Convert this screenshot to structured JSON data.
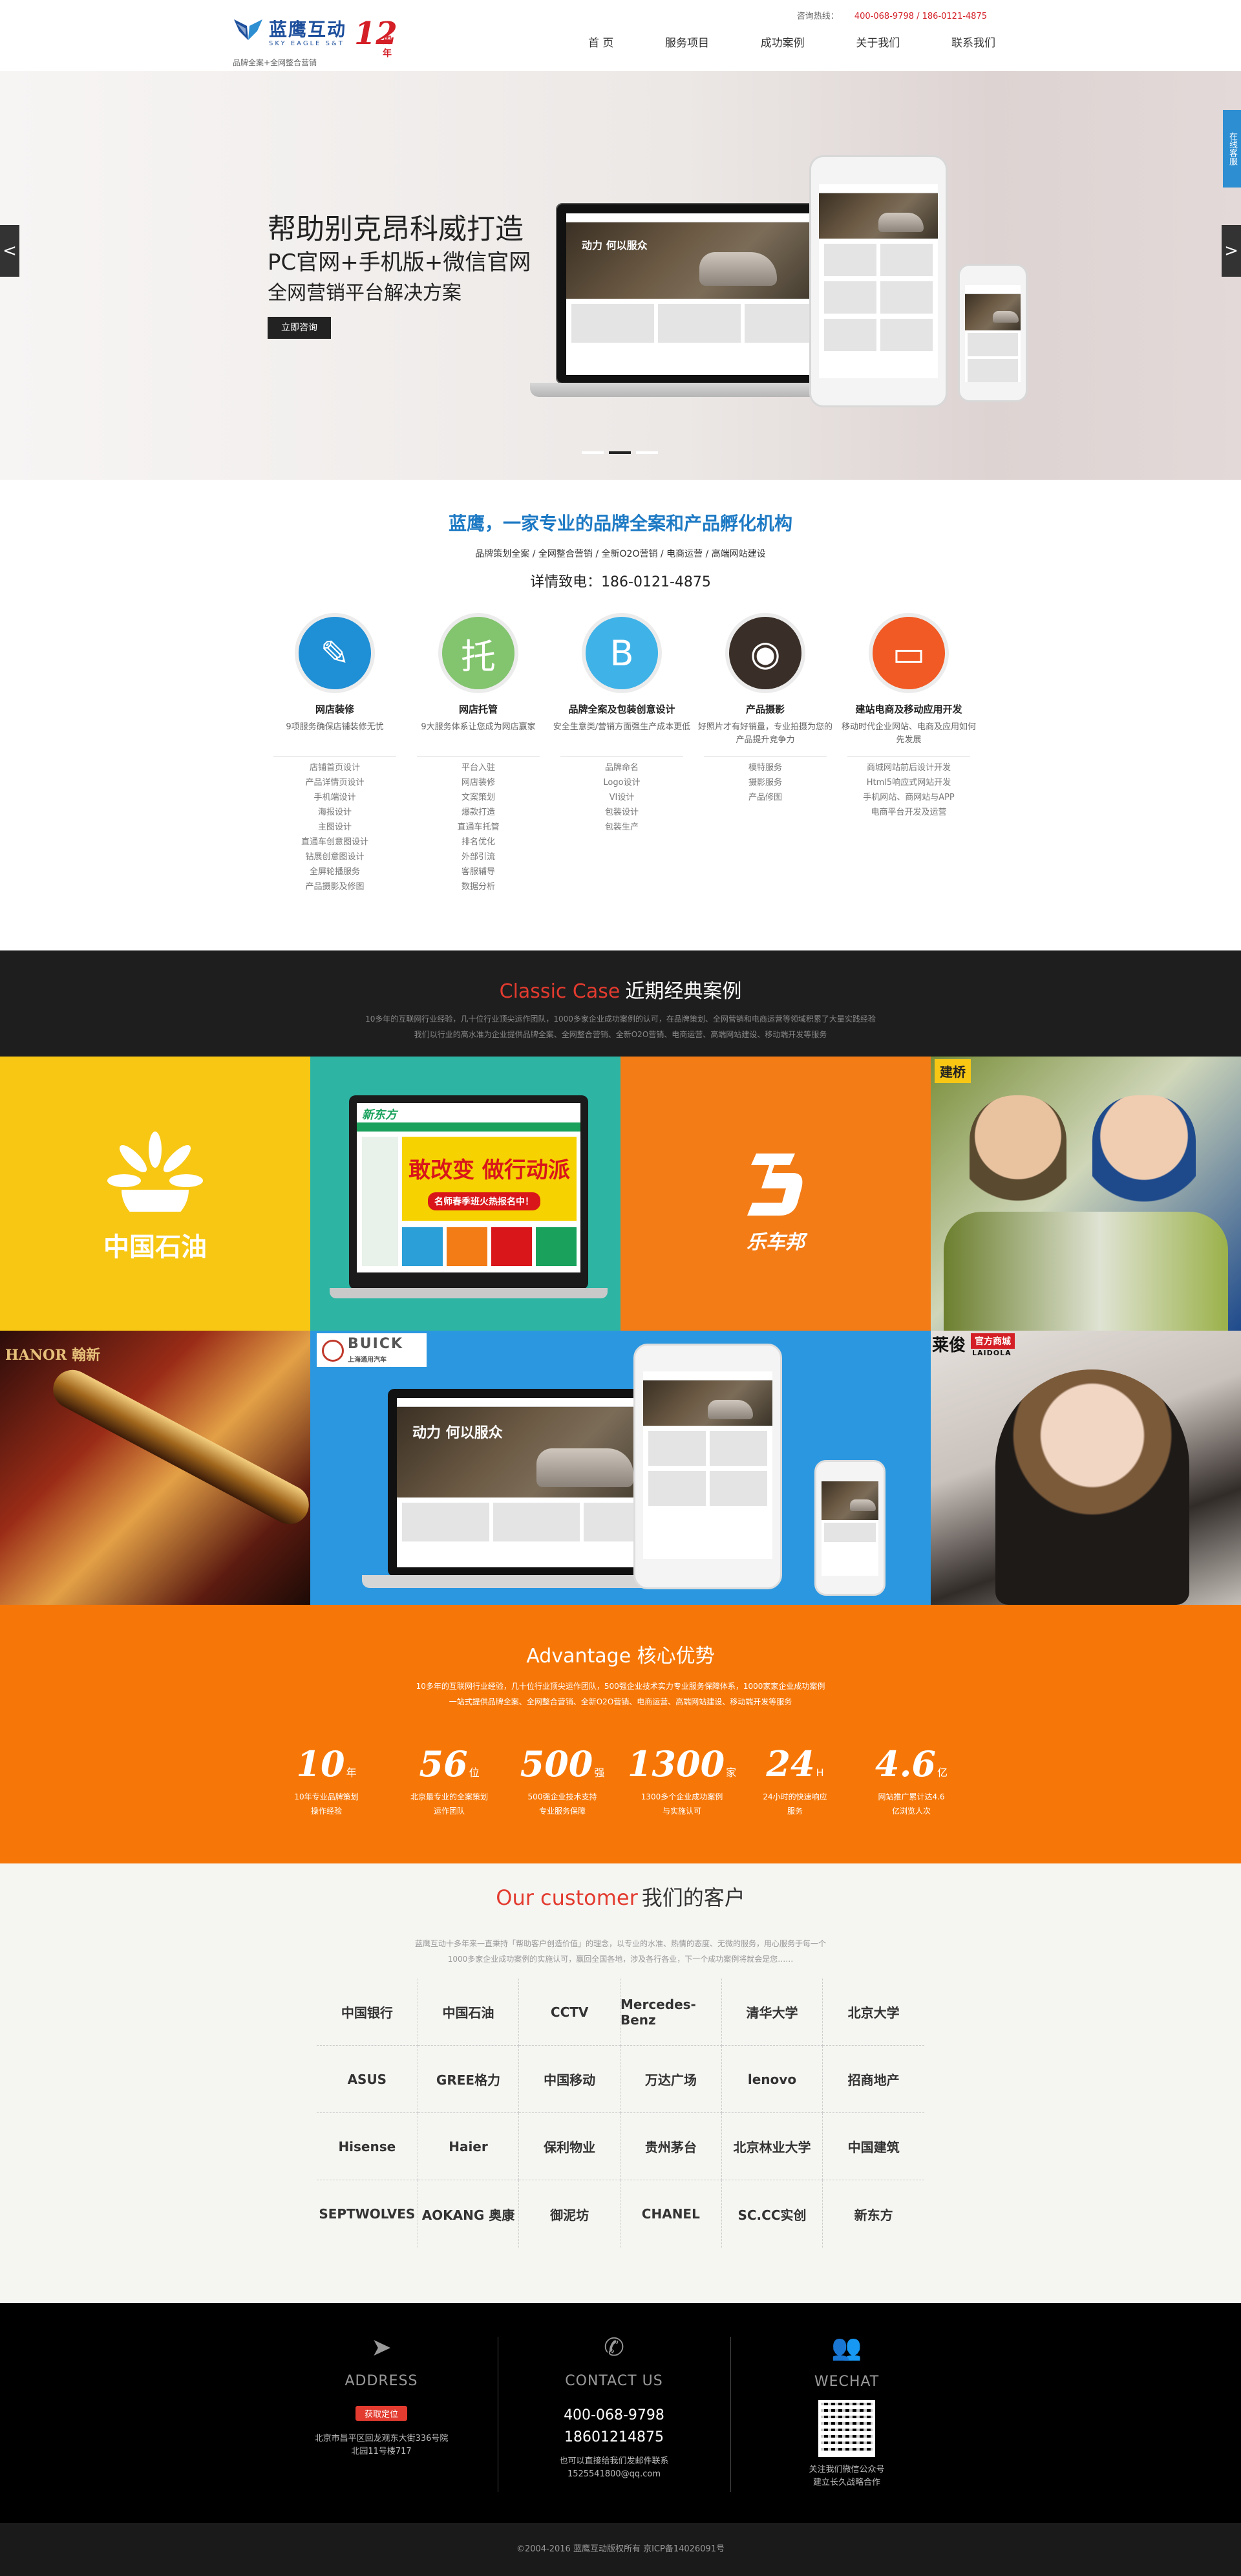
{
  "header": {
    "brand": "蓝鹰互动",
    "brand_en": "SKY EAGLE S&T",
    "tagline": "品牌全案+全网整合营销",
    "anniversary_number": "12",
    "anniversary_label": "周年",
    "hotline_label": "咨询热线：",
    "hotline_numbers": "400-068-9798 / 186-0121-4875",
    "nav": [
      "首 页",
      "服务项目",
      "成功案例",
      "关于我们",
      "联系我们"
    ]
  },
  "banner": {
    "title1": "帮助别克昂科威打造",
    "title2": "PC官网+手机版+微信官网",
    "title3": "全网营销平台解决方案",
    "cta": "立即咨询",
    "prev": "<",
    "next": ">",
    "side_service": "在线客服",
    "mock_headline": "动力 何以服众",
    "slide_count": 3,
    "active_slide": 2
  },
  "intro": {
    "title": "蓝鹰，一家专业的品牌全案和产品孵化机构",
    "subtitle": "品牌策划全案 / 全网整合营销 / 全新O2O营销 / 电商运营 / 高端网站建设",
    "phone": "详情致电：186-0121-4875"
  },
  "services": [
    {
      "icon": "pen-ruler-icon",
      "glyph": "✎",
      "color": "#1f8fd6",
      "name": "网店装修",
      "desc": "9项服务确保店铺装修无忧",
      "items": [
        "店铺首页设计",
        "产品详情页设计",
        "手机端设计",
        "海报设计",
        "主图设计",
        "直通车创意图设计",
        "钻展创意图设计",
        "全屏轮播服务",
        "产品摄影及修图"
      ]
    },
    {
      "icon": "tuo-icon",
      "glyph": "托",
      "color": "#83c46f",
      "name": "网店托管",
      "desc": "9大服务体系让您成为网店赢家",
      "items": [
        "平台入驻",
        "网店装修",
        "文案策划",
        "爆款打造",
        "直通车托管",
        "排名优化",
        "外部引流",
        "客服辅导",
        "数据分析"
      ]
    },
    {
      "icon": "letter-b-icon",
      "glyph": "B",
      "color": "#3fb3e8",
      "name": "品牌全案及包装创意设计",
      "desc": "安全生意类/营销方面强生产成本更低",
      "items": [
        "品牌命名",
        "Logo设计",
        "VI设计",
        "包装设计",
        "包装生产"
      ]
    },
    {
      "icon": "camera-lens-icon",
      "glyph": "◉",
      "color": "#3a2f28",
      "name": "产品摄影",
      "desc": "好照片才有好销量，专业拍摄为您的产品提升竞争力",
      "items": [
        "模特服务",
        "摄影服务",
        "产品修图"
      ]
    },
    {
      "icon": "browser-window-icon",
      "glyph": "▭",
      "color": "#f15a24",
      "name": "建站电商及移动应用开发",
      "desc": "移动时代企业网站、电商及应用如何先发展",
      "items": [
        "商城网站前后设计开发",
        "Html5响应式网站开发",
        "手机网站、商网站与APP",
        "电商平台开发及运营"
      ]
    }
  ],
  "case": {
    "title_en": "Classic Case",
    "title_cn": "近期经典案例",
    "desc_line1": "10多年的互联网行业经验，几十位行业顶尖运作团队，1000多家企业成功案例的认可，在品牌策划、全网营销和电商运营等领域积累了大量实践经验",
    "desc_line2": "我们以行业的高水准为企业提供品牌全案、全网整合营销、全新O2O营销、电商运营、高端网站建设、移动端开发等服务",
    "tiles": {
      "cnpc_name": "中国石油",
      "xdf_name": "新东方",
      "xdf_slogan": "敢改变 做行动派",
      "xdf_ribbon": "名师春季班火热报名中！",
      "lechebang_name": "乐车邦",
      "jianqiao_name": "建桥",
      "hanor_name": "HANOR 翰新",
      "buick_name": "BUICK",
      "buick_cn": "上海通用汽车",
      "laidola_name": "莱俊",
      "laidola_tag": "官方商城",
      "laidola_en": "LAIDOLA"
    }
  },
  "advantage": {
    "title": "Advantage 核心优势",
    "desc_line1": "10多年的互联网行业经验，几十位行业顶尖运作团队，500强企业技术实力专业服务保障体系，1000家家企业成功案例",
    "desc_line2": "一站式提供品牌全案、全网整合营销、全新O2O营销、电商运营、高端网站建设、移动端开发等服务",
    "stats": [
      {
        "value": "10",
        "unit": "年",
        "caption": "10年专业品牌策划\n操作经验"
      },
      {
        "value": "56",
        "unit": "位",
        "caption": "北京最专业的全案策划\n运作团队"
      },
      {
        "value": "500",
        "unit": "强",
        "caption": "500强企业技术支持\n专业服务保障"
      },
      {
        "value": "1300",
        "unit": "家",
        "caption": "1300多个企业成功案例\n与实施认可"
      },
      {
        "value": "24",
        "unit": "H",
        "caption": "24小时的快速响应\n服务"
      },
      {
        "value": "4.6",
        "unit": "亿",
        "caption": "网站推广累计达4.6\n亿浏览人次"
      }
    ]
  },
  "customers": {
    "title_en": "Our customer",
    "title_cn": "我们的客户",
    "desc_line1": "蓝鹰互动十多年来一直秉持「帮助客户创造价值」的理念，以专业的水准、热情的态度、无微的服务，用心服务于每一个",
    "desc_line2": "1000多家企业成功案例的实施认可，赢回全国各地，涉及各行各业，下一个成功案例将就会是您……",
    "logos": [
      "中国银行",
      "中国石油",
      "CCTV",
      "Mercedes-Benz",
      "清华大学",
      "北京大学",
      "ASUS",
      "GREE格力",
      "中国移动",
      "万达广场",
      "lenovo",
      "招商地产",
      "Hisense",
      "Haier",
      "保利物业",
      "贵州茅台",
      "北京林业大学",
      "中国建筑",
      "SEPTWOLVES",
      "AOKANG 奥康",
      "御泥坊",
      "CHANEL",
      "SC.CC实创",
      "新东方"
    ]
  },
  "footer": {
    "address_title": "ADDRESS",
    "map_button": "获取定位",
    "address_line1": "北京市昌平区回龙观东大街336号院",
    "address_line2": "北园11号楼717",
    "contact_title": "CONTACT US",
    "phone1": "400-068-9798",
    "phone2": "18601214875",
    "contact_note": "也可以直接给我们发邮件联系",
    "email": "1525541800@qq.com",
    "wechat_title": "WECHAT",
    "wechat_line1": "关注我们微信公众号",
    "wechat_line2": "建立长久战略合作",
    "copyright": "©2004-2016 蓝鹰互动版权所有 京ICP备14026091号"
  }
}
